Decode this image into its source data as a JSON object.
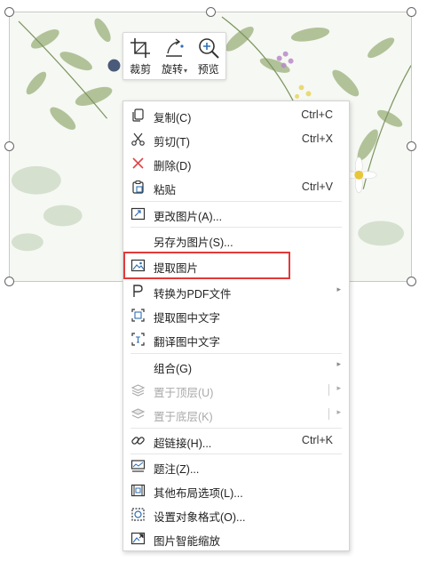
{
  "toolbar": {
    "crop_label": "裁剪",
    "rotate_label": "旋转",
    "preview_label": "预览"
  },
  "menu": {
    "copy": {
      "label": "复制(C)",
      "shortcut": "Ctrl+C"
    },
    "cut": {
      "label": "剪切(T)",
      "shortcut": "Ctrl+X"
    },
    "delete": {
      "label": "删除(D)"
    },
    "paste": {
      "label": "粘贴",
      "shortcut": "Ctrl+V"
    },
    "change_picture": {
      "label": "更改图片(A)..."
    },
    "save_as_picture": {
      "label": "另存为图片(S)..."
    },
    "extract_picture": {
      "label": "提取图片"
    },
    "convert_pdf": {
      "label": "转换为PDF文件"
    },
    "extract_text": {
      "label": "提取图中文字"
    },
    "translate_text": {
      "label": "翻译图中文字"
    },
    "group": {
      "label": "组合(G)"
    },
    "bring_to_front": {
      "label": "置于顶层(U)"
    },
    "send_to_back": {
      "label": "置于底层(K)"
    },
    "hyperlink": {
      "label": "超链接(H)...",
      "shortcut": "Ctrl+K"
    },
    "caption": {
      "label": "题注(Z)..."
    },
    "layout_options": {
      "label": "其他布局选项(L)..."
    },
    "format_object": {
      "label": "设置对象格式(O)..."
    },
    "smart_scale": {
      "label": "图片智能缩放"
    }
  },
  "colors": {
    "highlight": "#e03a3a",
    "accent_blue": "#2f6fb3",
    "delete_red": "#e04646"
  }
}
